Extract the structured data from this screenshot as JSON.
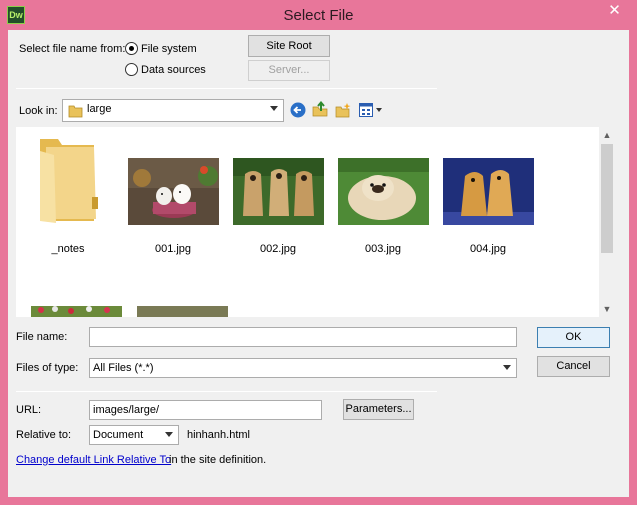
{
  "window": {
    "title": "Select File",
    "app_icon_text": "Dw",
    "close_glyph": "✕"
  },
  "select_from": {
    "label": "Select file name from:",
    "file_system": "File system",
    "data_sources": "Data sources",
    "selected": "file_system"
  },
  "buttons": {
    "site_root": "Site Root",
    "server": "Server...",
    "ok": "OK",
    "cancel": "Cancel",
    "parameters": "Parameters..."
  },
  "look_in": {
    "label": "Look in:",
    "value": "large"
  },
  "toolbar_icons": [
    "back-icon",
    "up-folder-icon",
    "new-folder-icon",
    "view-menu-icon"
  ],
  "files": [
    {
      "name": "_notes",
      "kind": "folder"
    },
    {
      "name": "001.jpg",
      "kind": "image"
    },
    {
      "name": "002.jpg",
      "kind": "image"
    },
    {
      "name": "003.jpg",
      "kind": "image"
    },
    {
      "name": "004.jpg",
      "kind": "image"
    }
  ],
  "file_name": {
    "label": "File name:",
    "value": ""
  },
  "files_of_type": {
    "label": "Files of type:",
    "value": "All Files (*.*)"
  },
  "url": {
    "label": "URL:",
    "value": "images/large/"
  },
  "relative_to": {
    "label": "Relative to:",
    "value": "Document",
    "file": "hinhanh.html"
  },
  "footer": {
    "link": "Change default Link Relative To",
    "text": " in the site definition."
  },
  "colors": {
    "frame": "#e8769a",
    "dialog_bg": "#f0f0f0",
    "link": "#0000cc",
    "ok_border": "#3c7fb1"
  }
}
